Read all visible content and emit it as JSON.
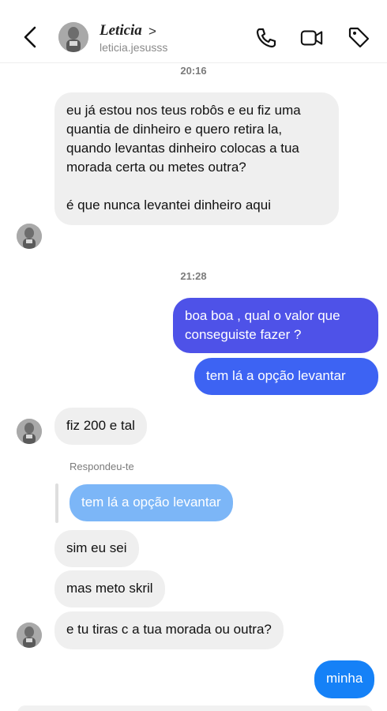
{
  "header": {
    "name": "Leticia",
    "username": "leticia.jesusss",
    "icons": [
      "back-chevron-icon",
      "phone-icon",
      "video-camera-icon",
      "tag-icon"
    ]
  },
  "timestamps": [
    "20:16",
    "21:28"
  ],
  "messages": {
    "m1_p1": "eu já estou nos teus robôs e eu fiz uma quantia de dinheiro e quero retira la, quando levantas dinheiro colocas a tua morada certa ou metes outra?",
    "m1_p2": "é que nunca levantei dinheiro aqui",
    "m2": "boa boa , qual o valor que conseguiste fazer ?",
    "m3": "tem lá a opção levantar",
    "m4": "fiz 200 e tal",
    "reply_label": "Respondeu-te",
    "reply_quote": "tem lá a opção levantar",
    "m5": "sim eu sei",
    "m6": "mas meto skril",
    "m7": "e tu tiras c a tua morada ou outra?",
    "m8": "minha"
  },
  "colors": {
    "incoming": "#efefef",
    "outgoing_purple": "#4e52e8",
    "outgoing_blue": "#3d63f3",
    "outgoing_sky": "#1581f7",
    "reply_quote": "#7cb6f7"
  }
}
